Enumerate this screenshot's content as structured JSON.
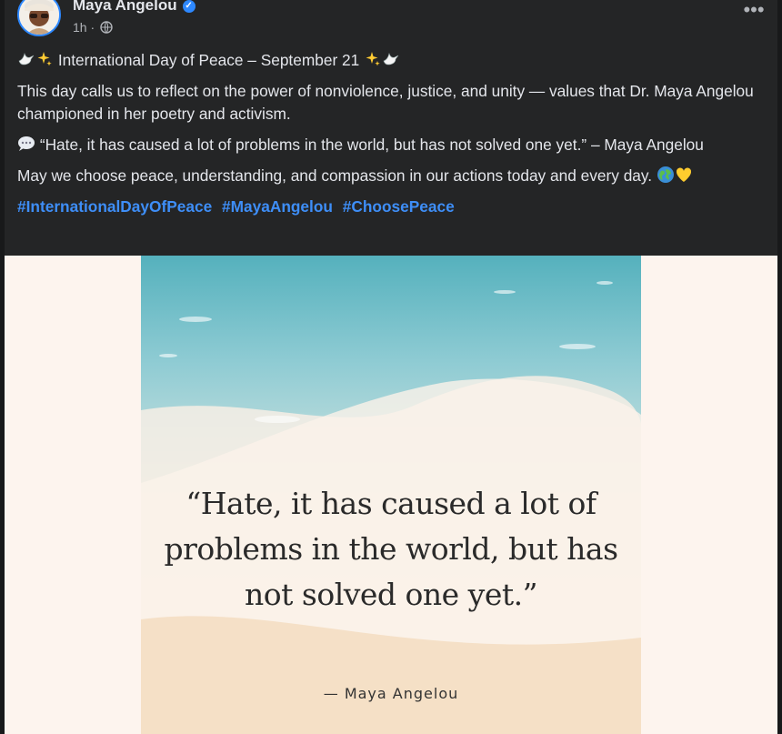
{
  "post": {
    "author": "Maya Angelou",
    "time": "1h",
    "more_label": "•••"
  },
  "content": {
    "title": "International Day of Peace – September 21",
    "paragraph1": "This day calls us to reflect on the power of nonviolence, justice, and unity — values that Dr. Maya Angelou championed in her poetry and activism.",
    "paragraph2": "“Hate, it has caused a lot of problems in the world, but has not solved one yet.” – Maya Angelou",
    "paragraph3": "May we choose peace, understanding, and compassion in our actions today and every day.",
    "hashtags": [
      "#InternationalDayOfPeace",
      "#MayaAngelou",
      "#ChoosePeace"
    ]
  },
  "image": {
    "quote": "“Hate, it has caused a lot of problems in the world, but has not solved one yet.”",
    "attribution": "— Maya Angelou"
  },
  "icons": {
    "verified": "verified-badge-icon",
    "audience": "globe-icon",
    "dove": "dove-icon",
    "sparkles": "sparkles-icon",
    "speech": "speech-bubble-icon",
    "earth": "earth-icon",
    "heart": "yellow-heart-icon"
  },
  "colors": {
    "background": "#242526",
    "text": "#e4e6eb",
    "secondary": "#b0b3b8",
    "link": "#3e8ef7",
    "accent": "#2d88ff"
  }
}
